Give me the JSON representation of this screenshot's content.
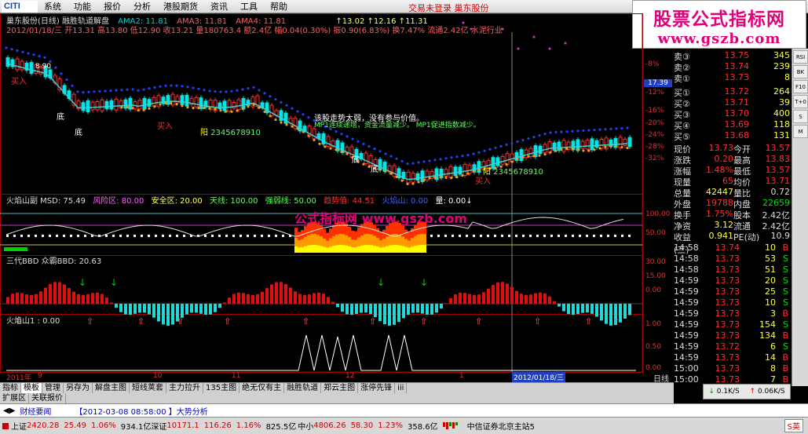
{
  "menu": {
    "logo_text": "CITI",
    "items": [
      "系统",
      "功能",
      "报价",
      "分析",
      "港股期货",
      "资讯",
      "工具",
      "帮助"
    ],
    "trade_status": "交易未登录  巢东股份"
  },
  "brand": {
    "line1": "股票公式指标网",
    "line2": "www.gszb.com"
  },
  "main_panel": {
    "title": "巢东股份(日线) 融胜轨道解盘",
    "ama2": "AMA2: 11.81",
    "ama3": "AMA3: 11.81",
    "ama4": "AMA4: 11.81",
    "extra": "↑13.02 ↑12.16 ↑11.31",
    "info": "2012/01/18/三 开13.31 高13.80 低12.90 收13.21 量180763.4 额2.4亿 幅0.04(0.30%) 振0.90(6.83%) 换7.47% 流通2.42亿 水泥行业",
    "annot1": "该股走势太弱，没有参与价值。",
    "annot2": "MP1连续递增，资金流量减少。",
    "annot3": "MP1促进指数减少。",
    "label_di1": "底",
    "label_di2": "底",
    "label_di3": "底",
    "label_di4": "底",
    "label_buy1": "买入",
    "label_buy2": "买入",
    "label_buy3": "买入",
    "label_yang1": "阳",
    "label_yang2": "阳",
    "seq1": "2345678910",
    "seq2": "2345678910",
    "ma_hint": "8.90",
    "price_current": "17.39",
    "y_ticks": [
      "-8%",
      "-12%",
      "-16%",
      "-20%",
      "-24%",
      "-28%",
      "-32%"
    ]
  },
  "panel2": {
    "title": "火焰山副 MSD: 75.49",
    "risk": "风险区: 80.00",
    "safe": "安全区: 20.00",
    "sky": "天线: 100.00",
    "strong_weak": "强弱线: 50.00",
    "trend": "趋势值: 44.51",
    "fire": "火焰山: 0.00",
    "volume": "量: 0.00↓",
    "watermark": "公式指标网 www.gszb.com",
    "y_ticks": [
      "100.00",
      "50.00"
    ]
  },
  "panel3": {
    "title": "三代BBD 众霸BBD: 20.63",
    "y_ticks": [
      "30.00",
      "15.00",
      "0.00"
    ]
  },
  "panel4": {
    "title": "火焰山1 : 0.00",
    "y_ticks": [
      "1.00",
      "0.50",
      "0.00"
    ]
  },
  "x_axis": {
    "labels": [
      "2011年",
      "9",
      "10",
      "11",
      "12",
      "1",
      "2012/01/18/三"
    ],
    "period": "日线"
  },
  "quotes": {
    "sell": [
      {
        "label": "卖③",
        "price": "13.75",
        "vol": "345"
      },
      {
        "label": "卖②",
        "price": "13.74",
        "vol": "239"
      },
      {
        "label": "卖①",
        "price": "13.73",
        "vol": "8"
      }
    ],
    "buy": [
      {
        "label": "买①",
        "price": "13.72",
        "vol": "264"
      },
      {
        "label": "买②",
        "price": "13.71",
        "vol": "39"
      },
      {
        "label": "买③",
        "price": "13.70",
        "vol": "400"
      },
      {
        "label": "买④",
        "price": "13.69",
        "vol": "118"
      },
      {
        "label": "买⑤",
        "price": "13.68",
        "vol": "131"
      }
    ],
    "stats": [
      [
        "现价",
        "13.73",
        "今开",
        "13.57"
      ],
      [
        "涨跌",
        "0.20",
        "最高",
        "13.83"
      ],
      [
        "涨幅",
        "1.48%",
        "最低",
        "13.57"
      ],
      [
        "现量",
        "65",
        "均价",
        "13.71"
      ],
      [
        "总量",
        "42447",
        "量比",
        "0.72"
      ],
      [
        "外盘",
        "19788",
        "内盘",
        "22659"
      ],
      [
        "换手",
        "1.75%",
        "股本",
        "2.42亿"
      ],
      [
        "净资",
        "3.12",
        "流通",
        "2.42亿"
      ],
      [
        "收益(三)",
        "0.941",
        "PE(动)",
        "10.9"
      ]
    ],
    "ticks": [
      [
        "14:58",
        "13.74",
        "10",
        "B"
      ],
      [
        "14:58",
        "13.73",
        "53",
        "S"
      ],
      [
        "14:58",
        "13.73",
        "51",
        "S"
      ],
      [
        "14:59",
        "13.73",
        "20",
        "S"
      ],
      [
        "14:59",
        "13.73",
        "25",
        "S"
      ],
      [
        "14:59",
        "13.73",
        "10",
        "S"
      ],
      [
        "14:59",
        "13.73",
        "3",
        "B"
      ],
      [
        "14:59",
        "13.73",
        "154",
        "S"
      ],
      [
        "14:59",
        "13.73",
        "134",
        "B"
      ],
      [
        "14:59",
        "13.72",
        "6",
        "S"
      ],
      [
        "14:59",
        "13.73",
        "14",
        "B"
      ],
      [
        "15:00",
        "13.73",
        "8",
        "B"
      ],
      [
        "15:00",
        "13.73",
        "7",
        "B"
      ]
    ]
  },
  "right_toolbar": [
    "RSI",
    "BK",
    "F10",
    "T+0",
    "S",
    "M"
  ],
  "bottom_tabs": [
    "指标",
    "模板",
    "管理",
    "另存为",
    "解盘主图",
    "短线荚套",
    "主力拉升",
    "135主图",
    "绝无仅有主",
    "融胜轨道",
    "郑云主图",
    "涨停先锋"
  ],
  "bottom_tabs_more": "iii",
  "ext_tabs": [
    "扩展区",
    "关联报价"
  ],
  "speed": {
    "down": "0.1K/S",
    "up": "0.06K/S"
  },
  "news": {
    "title": "财经要闻",
    "item": "【2012-03-08 08:58:00 】大势分析"
  },
  "status": {
    "sh_label": "上证",
    "sh_val": "2420.28",
    "sh_chg": "25.49",
    "sh_pct": "1.06%",
    "sh_amt": "934.1亿",
    "sz_label": "深证",
    "sz_val": "10171.1",
    "sz_chg": "116.26",
    "sz_pct": "1.16%",
    "sz_amt": "825.5亿",
    "zx_label": "中小",
    "zx_val": "4806.26",
    "zx_chg": "58.30",
    "zx_pct": "1.23%",
    "zx_amt": "358.6亿",
    "broker": "中信证券北京主站5",
    "ime": "S英"
  },
  "colors": {
    "up": "#ff3030",
    "down": "#00e5e5",
    "blue_dot": "#2040ff",
    "orange": "#ff9900",
    "yellow": "#ffff00",
    "green": "#00d000",
    "cyan_line": "#40d0d0",
    "brand_pink": "#e0007a"
  }
}
